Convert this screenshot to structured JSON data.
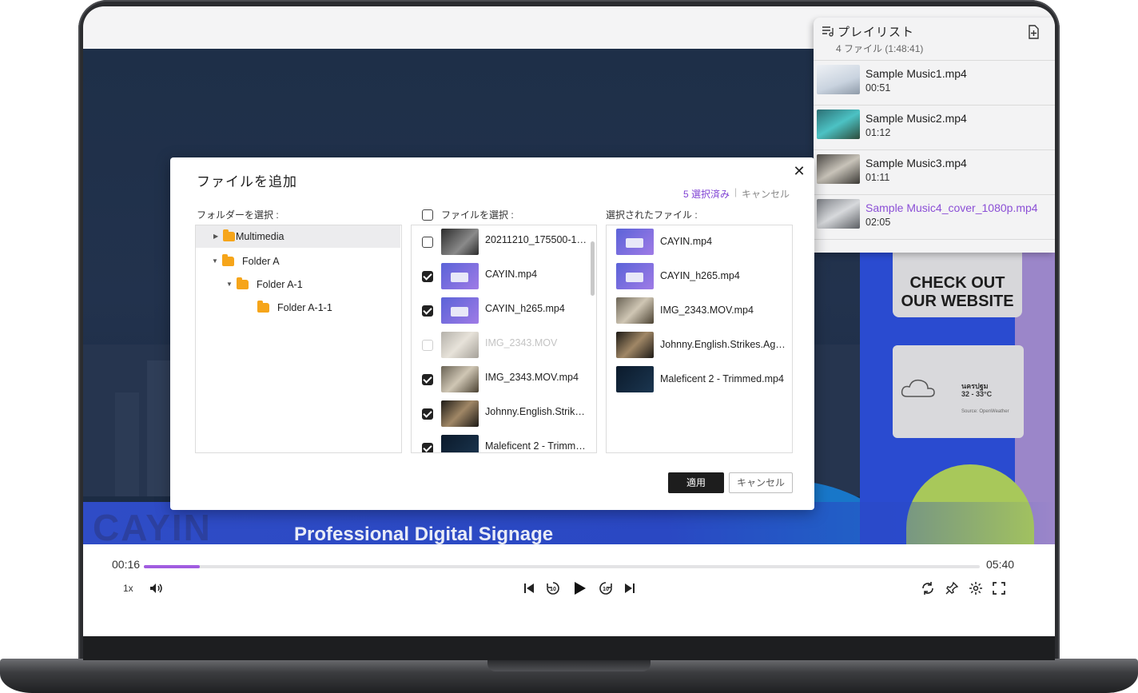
{
  "dialog": {
    "title": "ファイルを追加",
    "selected_count": "5 選択済み",
    "separator": "|",
    "cancel_link": "キャンセル",
    "close": "✕",
    "folder_label": "フォルダーを選択 :",
    "file_label": "ファイルを選択 :",
    "selected_label": "選択されたファイル :",
    "apply": "適用",
    "cancel": "キャンセル",
    "folders": [
      {
        "label": "Multimedia",
        "expanded": false,
        "selected": true
      },
      {
        "label": "Folder A",
        "expanded": true,
        "selected": false
      },
      {
        "label": "Folder A-1",
        "expanded": true,
        "selected": false
      },
      {
        "label": "Folder A-1-1",
        "expanded": false,
        "selected": false
      }
    ],
    "files": [
      {
        "name": "20211210_175500-17...",
        "checked": false,
        "disabled": false
      },
      {
        "name": "CAYIN.mp4",
        "checked": true,
        "disabled": false
      },
      {
        "name": "CAYIN_h265.mp4",
        "checked": true,
        "disabled": false
      },
      {
        "name": "IMG_2343.MOV",
        "checked": false,
        "disabled": true
      },
      {
        "name": "IMG_2343.MOV.mp4",
        "checked": true,
        "disabled": false
      },
      {
        "name": "Johnny.English.Strikes...",
        "checked": true,
        "disabled": false
      },
      {
        "name": "Maleficent 2 - Trimme...",
        "checked": true,
        "disabled": false
      }
    ],
    "selected_files": [
      {
        "name": "CAYIN.mp4"
      },
      {
        "name": "CAYIN_h265.mp4"
      },
      {
        "name": "IMG_2343.MOV.mp4"
      },
      {
        "name": "Johnny.English.Strikes.Again..."
      },
      {
        "name": "Maleficent 2 - Trimmed.mp4"
      }
    ]
  },
  "playlist": {
    "title": "プレイリスト",
    "summary": "4 ファイル (1:48:41)",
    "items": [
      {
        "name": "Sample Music1.mp4",
        "duration": "00:51",
        "active": false
      },
      {
        "name": "Sample Music2.mp4",
        "duration": "01:12",
        "active": false
      },
      {
        "name": "Sample Music3.mp4",
        "duration": "01:11",
        "active": false
      },
      {
        "name": "Sample Music4_cover_1080p.mp4",
        "duration": "02:05",
        "active": true
      }
    ]
  },
  "player": {
    "current_time": "00:16",
    "total_time": "05:40",
    "progress": 0.067,
    "speed": "1x"
  },
  "video": {
    "brand": "CAYIN",
    "tagline": "Professional Digital Signage",
    "qr_text_1": "CHECK OUT",
    "qr_text_2": "OUR WEBSITE",
    "weather_city": "นครปฐม",
    "weather_temp": "32 - 33°C",
    "weather_source": "Source: OpenWeather"
  },
  "colors": {
    "accent": "#8b4fd6",
    "progress": "#a15ce0",
    "apply_bg": "#1d1d1d"
  }
}
